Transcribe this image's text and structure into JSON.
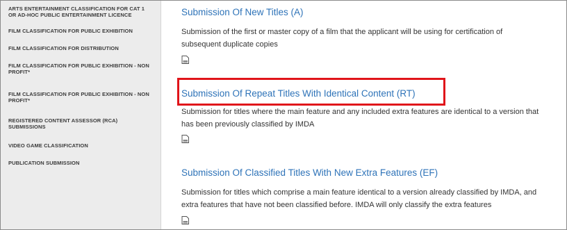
{
  "sidebar": {
    "items": [
      {
        "label": "ARTS ENTERTAINMENT CLASSIFICATION FOR CAT 1 OR AD-HOC PUBLIC ENTERTAINMENT LICENCE"
      },
      {
        "label": "FILM CLASSIFICATION FOR PUBLIC EXHIBITION"
      },
      {
        "label": "FILM CLASSIFICATION FOR DISTRIBUTION"
      },
      {
        "label": "FILM CLASSIFICATION FOR PUBLIC EXHIBITION - NON PROFIT*"
      },
      {
        "label": "FILM CLASSIFICATION FOR PUBLIC EXHIBITION - NON PROFIT*"
      },
      {
        "label": "REGISTERED CONTENT ASSESSOR (RCA) SUBMISSIONS"
      },
      {
        "label": "VIDEO GAME CLASSIFICATION"
      },
      {
        "label": "PUBLICATION SUBMISSION"
      }
    ]
  },
  "sections": [
    {
      "title": "Submission Of New Titles (A)",
      "desc_lines": [
        "Submission of the first or master copy of a film that the applicant will be using for certification of",
        "subsequent duplicate copies"
      ],
      "icon": "document-icon"
    },
    {
      "title": "Submission Of Repeat Titles With Identical Content (RT)",
      "desc_lines": [
        "Submission for titles where the main feature and any included extra features are identical to a version that",
        "has been previously classified by IMDA"
      ],
      "icon": "document-icon"
    },
    {
      "title": "Submission Of Classified Titles With New Extra Features (EF)",
      "desc_lines": [
        "Submission for titles which comprise a main feature identical to a version already classified by IMDA, and",
        "extra features that have not been classified before. IMDA will only classify the extra features"
      ],
      "icon": "document-icon"
    }
  ],
  "colors": {
    "link": "#2e73b8",
    "highlight": "#e0141a",
    "sidebar_bg": "#ececec"
  }
}
